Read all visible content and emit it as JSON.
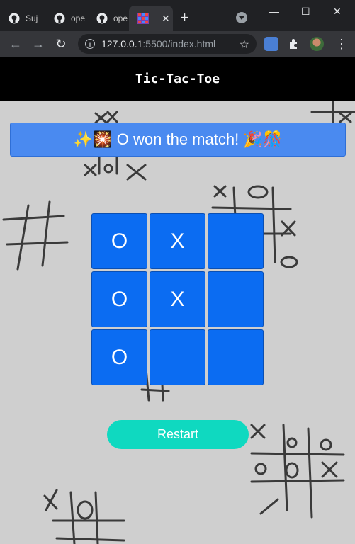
{
  "browser": {
    "tabs": [
      {
        "label": "Suj"
      },
      {
        "label": "ope"
      },
      {
        "label": "ope"
      },
      {
        "label": ""
      }
    ],
    "new_tab": "+",
    "url_host": "127.0.0.1",
    "url_path": ":5500/index.html",
    "window_controls": {
      "minimize": "—",
      "maximize": "☐",
      "close": "✕"
    }
  },
  "page": {
    "title": "Tic-Tac-Toe",
    "status": "✨🎇 O won the match! 🎉🎊",
    "board": [
      "O",
      "X",
      "",
      "O",
      "X",
      "",
      "O",
      "",
      ""
    ],
    "restart_label": "Restart"
  },
  "colors": {
    "cell": "#0b6cf2",
    "status": "#4a8af0",
    "restart": "#0fd9c0",
    "header": "#000000"
  }
}
